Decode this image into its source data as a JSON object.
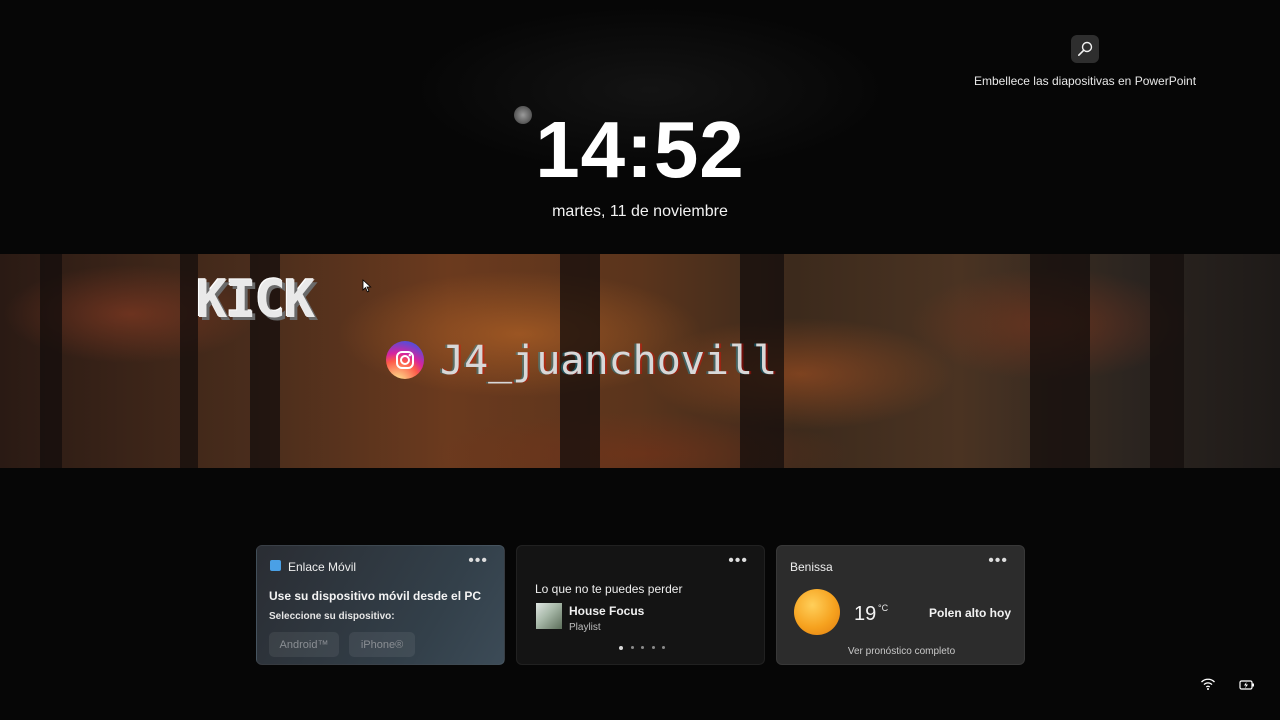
{
  "spotlight": {
    "icon": "search-icon",
    "caption": "Embellece las diapositivas en PowerPoint"
  },
  "clock": {
    "time": "14:52",
    "date": "martes, 11 de noviembre"
  },
  "banner": {
    "logo_text": "KICK",
    "instagram_icon": "instagram-icon",
    "instagram_handle": "J4_juanchovill"
  },
  "widgets": {
    "phone_link": {
      "title": "Enlace Móvil",
      "more": "•••",
      "headline": "Use su dispositivo móvil desde el PC",
      "prompt": "Seleccione su dispositivo:",
      "options": [
        "Android™",
        "iPhone®"
      ]
    },
    "media": {
      "title": "Lo que no te puedes perder",
      "more": "•••",
      "track": "House Focus",
      "type": "Playlist",
      "pages": 5,
      "active_page": 1
    },
    "weather": {
      "location": "Benissa",
      "more": "•••",
      "temperature": "19",
      "unit": "°C",
      "condition_icon": "sun-icon",
      "alert": "Polen alto hoy",
      "link": "Ver pronóstico completo"
    }
  },
  "tray": {
    "network_icon": "wifi-icon",
    "battery_icon": "battery-charging-icon"
  },
  "colors": {
    "background": "#060606",
    "phone_link_accent": "#4aa0e6",
    "sun": "#f6a21f"
  }
}
